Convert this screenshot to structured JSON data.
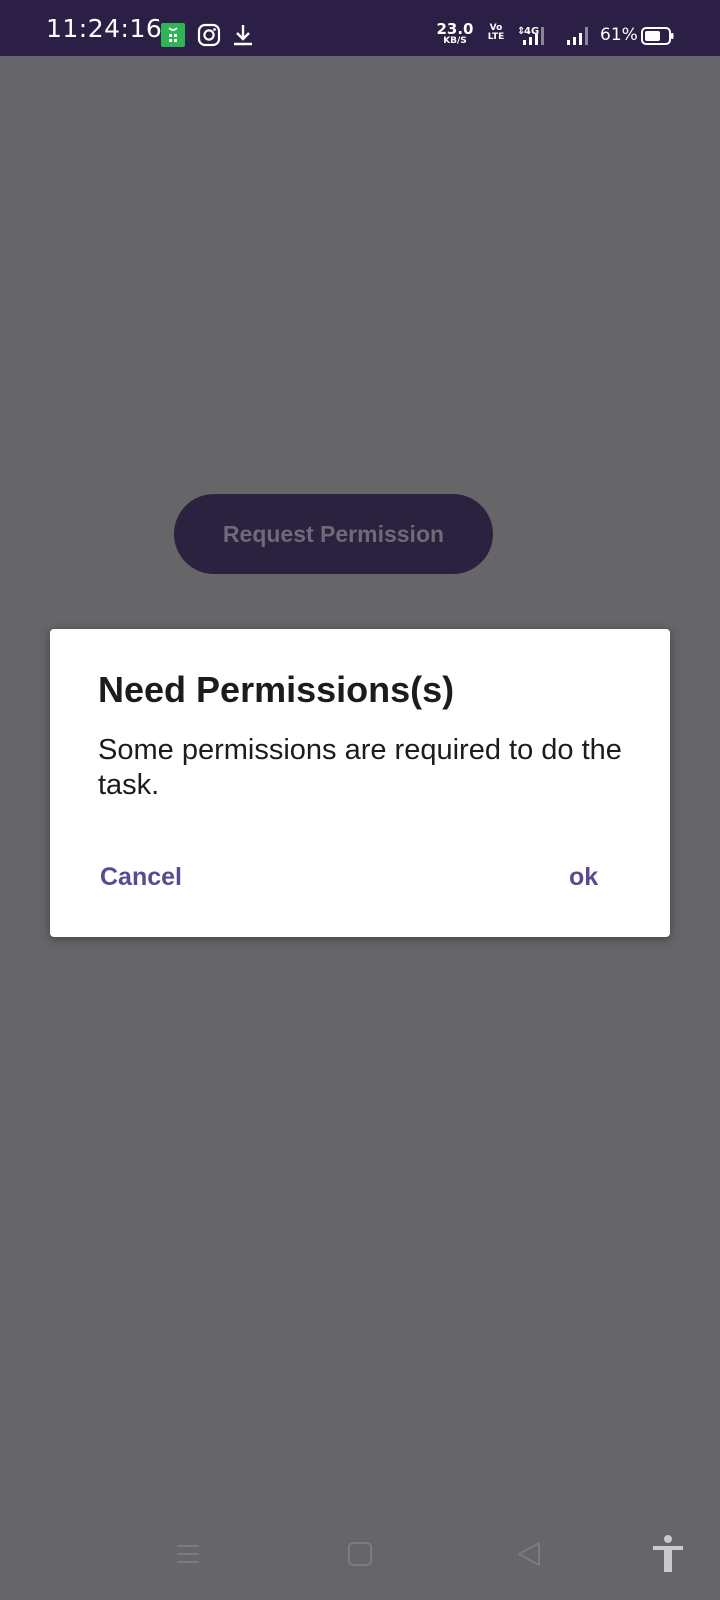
{
  "status_bar": {
    "time": "11:24:16",
    "net_speed_value": "23.0",
    "net_speed_unit": "KB/S",
    "volte_top": "Vo",
    "volte_bottom": "LTE",
    "network_type": "4G",
    "battery_percent": "61%",
    "icons": [
      "app-notification-icon",
      "instagram-icon",
      "download-icon",
      "signal-icon",
      "battery-icon"
    ]
  },
  "main": {
    "request_button_label": "Request Permission"
  },
  "dialog": {
    "title": "Need Permissions(s)",
    "message": "Some permissions are required to do the task.",
    "cancel_label": "Cancel",
    "ok_label": "ok"
  },
  "nav_bar": {
    "icons": [
      "menu-icon",
      "home-icon",
      "back-icon",
      "accessibility-icon"
    ]
  },
  "colors": {
    "status_bar": "#2b1f45",
    "scrim": "#666568",
    "accent": "#5b4a91",
    "button_bg": "#2b2240"
  }
}
